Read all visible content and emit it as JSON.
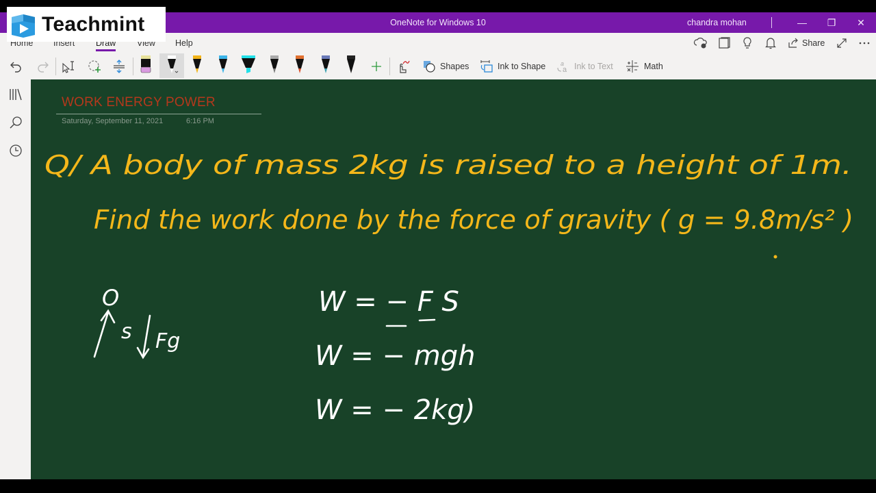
{
  "window": {
    "app_title": "OneNote for Windows 10",
    "user_name": "chandra mohan",
    "minimize_glyph": "—",
    "restore_glyph": "❐",
    "close_glyph": "✕"
  },
  "watermark": {
    "brand": "Teachmint",
    "accent": "#2b9be0"
  },
  "ribbon": {
    "tabs": [
      {
        "label": "Home"
      },
      {
        "label": "Insert"
      },
      {
        "label": "Draw",
        "active": true
      },
      {
        "label": "View"
      },
      {
        "label": "Help"
      }
    ],
    "right": {
      "share_label": "Share",
      "icons": [
        "sync-status-icon",
        "notebook-icon",
        "lightbulb-icon",
        "bell-icon",
        "share-icon",
        "expand-icon",
        "more-icon"
      ]
    }
  },
  "draw_toolbar": {
    "undo": "undo-icon",
    "redo": "redo-icon",
    "pens": [
      {
        "name": "eraser",
        "band": "#e8e29a",
        "tip": "#d99be0"
      },
      {
        "name": "black-pen",
        "band": "#ffffff",
        "tip": "#ffffff",
        "selected": true
      },
      {
        "name": "yellow-pen",
        "band": "#f2b318",
        "tip": "#f2b318"
      },
      {
        "name": "blue-pen",
        "band": "#3cb4e8",
        "tip": "#3cb4e8"
      },
      {
        "name": "cyan-highlighter",
        "band": "#22e0e8",
        "tip": "#22e0e8"
      },
      {
        "name": "galaxy-pen",
        "band": "#aaaaaa",
        "tip": "#777777"
      },
      {
        "name": "rainbow-pen",
        "band": "#e07030",
        "tip": "#d9502a"
      },
      {
        "name": "ocean-pen",
        "band": "#6a7ab8",
        "tip": "#3aa0b0"
      },
      {
        "name": "black-pen-2",
        "band": "#222222",
        "tip": "#111111"
      }
    ],
    "shapes_label": "Shapes",
    "ink_to_shape_label": "Ink to Shape",
    "ink_to_text_label": "Ink to Text",
    "math_label": "Math"
  },
  "page": {
    "title": "WORK ENERGY POWER",
    "date": "Saturday, September 11, 2021",
    "time": "6:16 PM",
    "background": "#184228",
    "ink": {
      "question_color": "#f4b71a",
      "work_color": "#ffffff",
      "question_line1": "Q/  A body of mass 2kg is raised to a height of 1m.",
      "question_line2": "Find the work done by the force of gravity ( g = 9.8m/s² )",
      "diagram": {
        "top_label": "O",
        "displacement": "s",
        "force": "Fg"
      },
      "equations": [
        "W = − F S",
        "W = − mgh",
        "W = − 2kg)"
      ]
    }
  }
}
